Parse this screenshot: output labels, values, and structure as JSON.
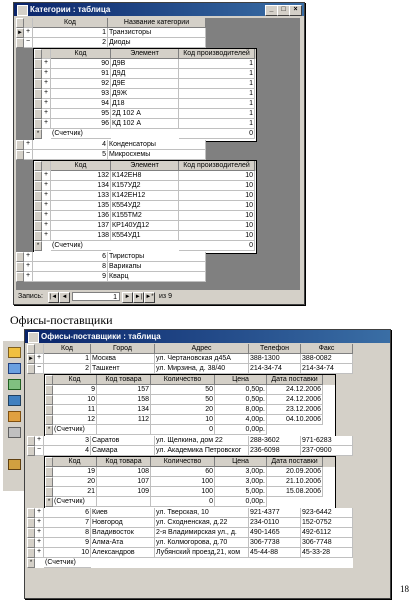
{
  "window1": {
    "title": "Категории : таблица",
    "cols": [
      "Код",
      "Название категории"
    ],
    "categories": [
      {
        "code": "1",
        "name": "Транзисторы",
        "exp": "+"
      },
      {
        "code": "2",
        "name": "Диоды",
        "exp": "−"
      },
      {
        "code": "4",
        "name": "Конденсаторы",
        "exp": "+"
      },
      {
        "code": "5",
        "name": "Микросхемы",
        "exp": "−"
      },
      {
        "code": "6",
        "name": "Тиристоры",
        "exp": "+"
      },
      {
        "code": "8",
        "name": "Варикапы",
        "exp": "+"
      },
      {
        "code": "9",
        "name": "Кварц",
        "exp": "+"
      }
    ],
    "sub_cols": [
      "Код",
      "Элемент",
      "Код производителей"
    ],
    "diodes": [
      {
        "code": "90",
        "elem": "Д9В",
        "maker": "1"
      },
      {
        "code": "91",
        "elem": "Д9Д",
        "maker": "1"
      },
      {
        "code": "92",
        "elem": "Д9Е",
        "maker": "1"
      },
      {
        "code": "93",
        "elem": "Д9Ж",
        "maker": "1"
      },
      {
        "code": "94",
        "elem": "Д18",
        "maker": "1"
      },
      {
        "code": "95",
        "elem": "2Д 102 А",
        "maker": "1"
      },
      {
        "code": "96",
        "elem": "КД 102 А",
        "maker": "1"
      }
    ],
    "chips": [
      {
        "code": "132",
        "elem": "К142ЕН8",
        "maker": "10"
      },
      {
        "code": "134",
        "elem": "К157УД2",
        "maker": "10"
      },
      {
        "code": "133",
        "elem": "К142ЕН12",
        "maker": "10"
      },
      {
        "code": "135",
        "elem": "К554УД2",
        "maker": "10"
      },
      {
        "code": "136",
        "elem": "К155ТМ2",
        "maker": "10"
      },
      {
        "code": "137",
        "elem": "КР140УД12",
        "maker": "10"
      },
      {
        "code": "138",
        "elem": "К554УД1",
        "maker": "10"
      }
    ],
    "counter_label": "(Счетчик)",
    "counter_value": "0",
    "record_label": "Запись:",
    "record_current": "1",
    "record_of": "из  9"
  },
  "caption": "Офисы-поставщики",
  "window2": {
    "title": "Офисы-поставщики : таблица",
    "cols": [
      "Код",
      "Город",
      "Адрес",
      "Телефон",
      "Факс"
    ],
    "offices": [
      {
        "code": "1",
        "city": "Москва",
        "addr": "ул. Чертановская д45А",
        "phone": "388-1300",
        "fax": "388-0082",
        "exp": "+"
      },
      {
        "code": "2",
        "city": "Ташкент",
        "addr": "ул. Мирзина, д. 38/40",
        "phone": "214-34-74",
        "fax": "214-34-74",
        "exp": "−"
      },
      {
        "code": "3",
        "city": "Саратов",
        "addr": "ул. Щелкина, дом 22",
        "phone": "288-3602",
        "fax": "971-6283",
        "exp": "+"
      },
      {
        "code": "4",
        "city": "Самара",
        "addr": "ул. Академика Петровског",
        "phone": "236-6098",
        "fax": "237-0900",
        "exp": "−"
      },
      {
        "code": "6",
        "city": "Киев",
        "addr": "ул. Тверская, 10",
        "phone": "921-4377",
        "fax": "923-6442",
        "exp": "+"
      },
      {
        "code": "7",
        "city": "Новгород",
        "addr": "ул. Сходненская, д.22",
        "phone": "234-0110",
        "fax": "152-0752",
        "exp": "+"
      },
      {
        "code": "8",
        "city": "Владивосток",
        "addr": "2-я Владимирская ул., д.",
        "phone": "490-1465",
        "fax": "492-6112",
        "exp": "+"
      },
      {
        "code": "9",
        "city": "Алма-Ата",
        "addr": "ул. Колмогорова, д.70",
        "phone": "306-7738",
        "fax": "306-7748",
        "exp": "+"
      },
      {
        "code": "10",
        "city": "Александров",
        "addr": "Лубянский проезд,21, ком",
        "phone": "45-44-88",
        "fax": "45-33-28",
        "exp": "+"
      }
    ],
    "sub_cols": [
      "Код",
      "Код товара",
      "Количество",
      "Цена",
      "Дата поставки"
    ],
    "tashkent": [
      {
        "code": "9",
        "item": "157",
        "qty": "50",
        "price": "0,50р.",
        "date": "24.12.2006"
      },
      {
        "code": "10",
        "item": "158",
        "qty": "50",
        "price": "0,50р.",
        "date": "24.12.2006"
      },
      {
        "code": "11",
        "item": "134",
        "qty": "20",
        "price": "8,00р.",
        "date": "23.12.2006"
      },
      {
        "code": "12",
        "item": "112",
        "qty": "10",
        "price": "4,00р.",
        "date": "04.10.2006"
      }
    ],
    "samara": [
      {
        "code": "19",
        "item": "108",
        "qty": "60",
        "price": "3,00р.",
        "date": "20.09.2006"
      },
      {
        "code": "20",
        "item": "107",
        "qty": "100",
        "price": "3,00р.",
        "date": "21.10.2006"
      },
      {
        "code": "21",
        "item": "109",
        "qty": "100",
        "price": "5,00р.",
        "date": "15.08.2006"
      }
    ],
    "counter_label": "(Счетчик)",
    "counter_value": "0",
    "price_zero": "0,00р."
  },
  "page_number": "18"
}
